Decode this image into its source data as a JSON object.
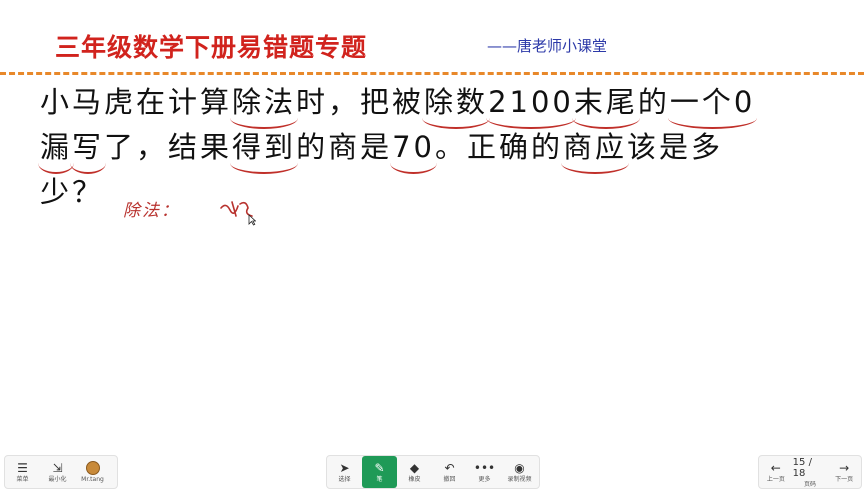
{
  "header": {
    "title": "三年级数学下册易错题专题",
    "subtitle": "——唐老师小课堂"
  },
  "question": {
    "line1": [
      "小马虎在计算",
      "除法",
      "时，把被",
      "除数",
      "2100",
      "末尾",
      "的",
      "一个0"
    ],
    "line2": [
      "漏",
      "写",
      "了，结果",
      "得到",
      "的商是",
      "70",
      "。正确的",
      "商应",
      "该是多"
    ],
    "line3": [
      "少？"
    ]
  },
  "annotation": {
    "label": "除法："
  },
  "toolbar": {
    "menu_label": "菜单",
    "minimize_label": "最小化",
    "user_label": "Mr.tang",
    "select_label": "选择",
    "pen_label": "笔",
    "eraser_label": "橡皮",
    "undo_label": "撤回",
    "more_label": "更多",
    "record_label": "录制视频",
    "prev_label": "上一页",
    "page_indicator": "15 / 18",
    "page_label": "页码",
    "next_label": "下一页"
  },
  "colors": {
    "title": "#d1231d",
    "subtitle": "#2c39a8",
    "divider": "#e8882a",
    "underline": "#c0302a",
    "active_tool": "#1f9a57"
  },
  "icons": [
    "menu-icon",
    "minimize-icon",
    "avatar-icon",
    "cursor-icon",
    "pen-icon",
    "eraser-icon",
    "undo-icon",
    "more-icon",
    "record-icon",
    "prev-icon",
    "next-icon"
  ]
}
